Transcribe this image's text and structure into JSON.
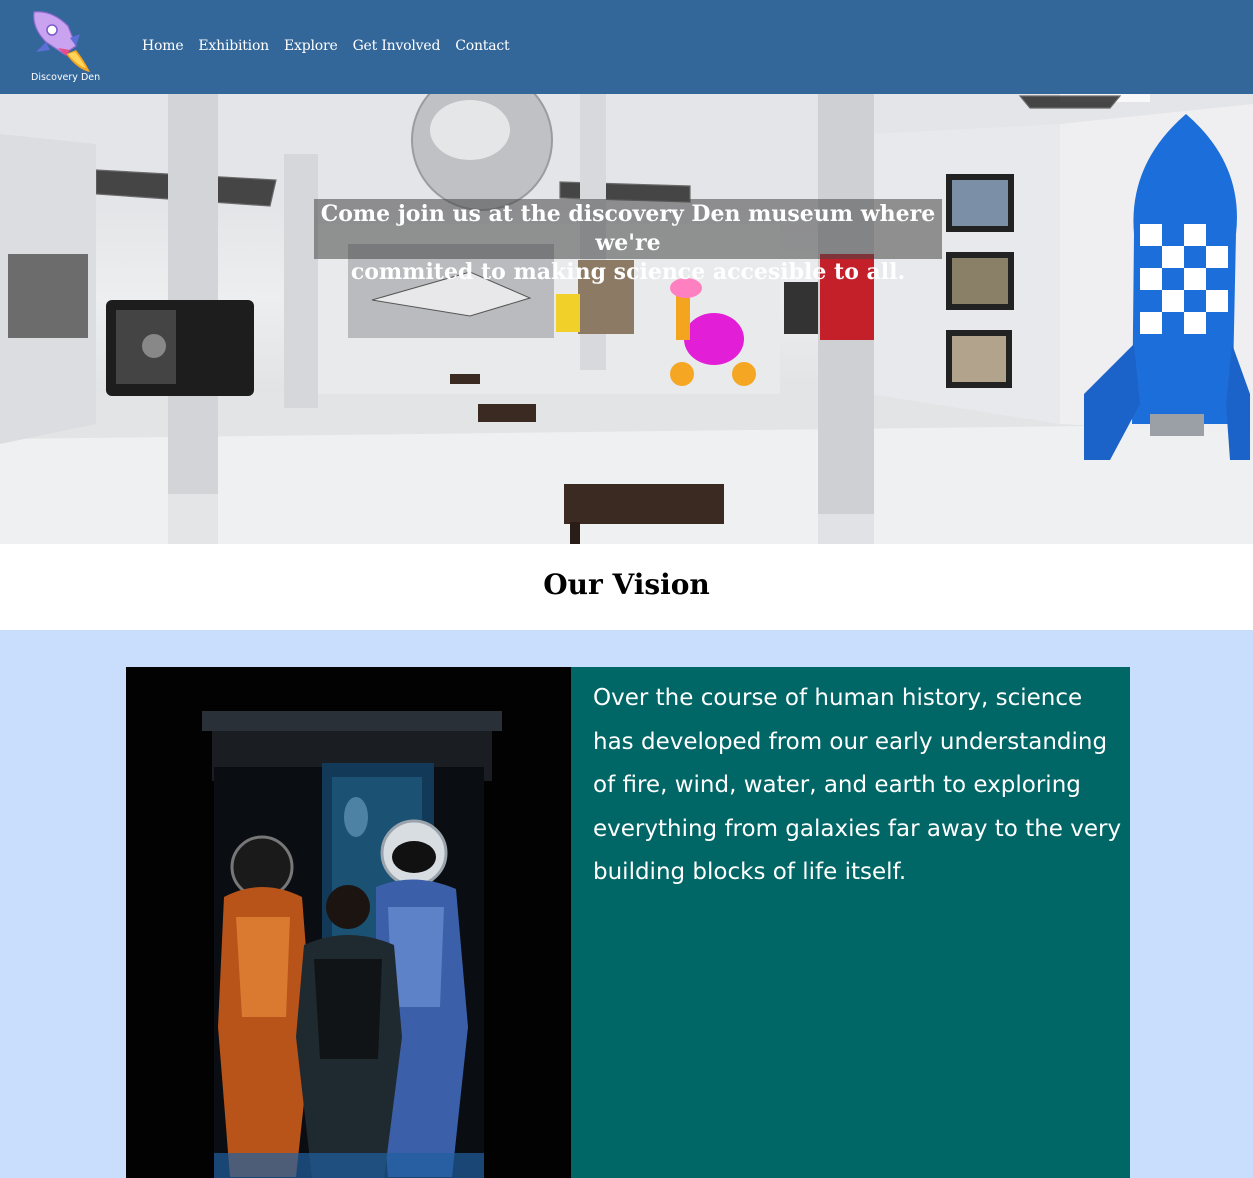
{
  "header": {
    "logo_text": "Discovery Den",
    "nav": [
      "Home",
      "Exhibition",
      "Explore",
      "Get Involved",
      "Contact"
    ]
  },
  "hero": {
    "caption_line1": "Come join us at the discovery Den museum where we're",
    "caption_line2": "commited to making science accesible to all."
  },
  "vision": {
    "title": "Our Vision",
    "text": "Over the course of human history, science has developed from our early understanding of fire, wind, water, and earth to exploring everything from galaxies far away to the very building blocks of life itself."
  },
  "colors": {
    "header_bg": "#336699",
    "section_bg": "#c9defc",
    "text_box_bg": "#006666"
  },
  "icons": {
    "logo": "rocket-logo-icon"
  }
}
